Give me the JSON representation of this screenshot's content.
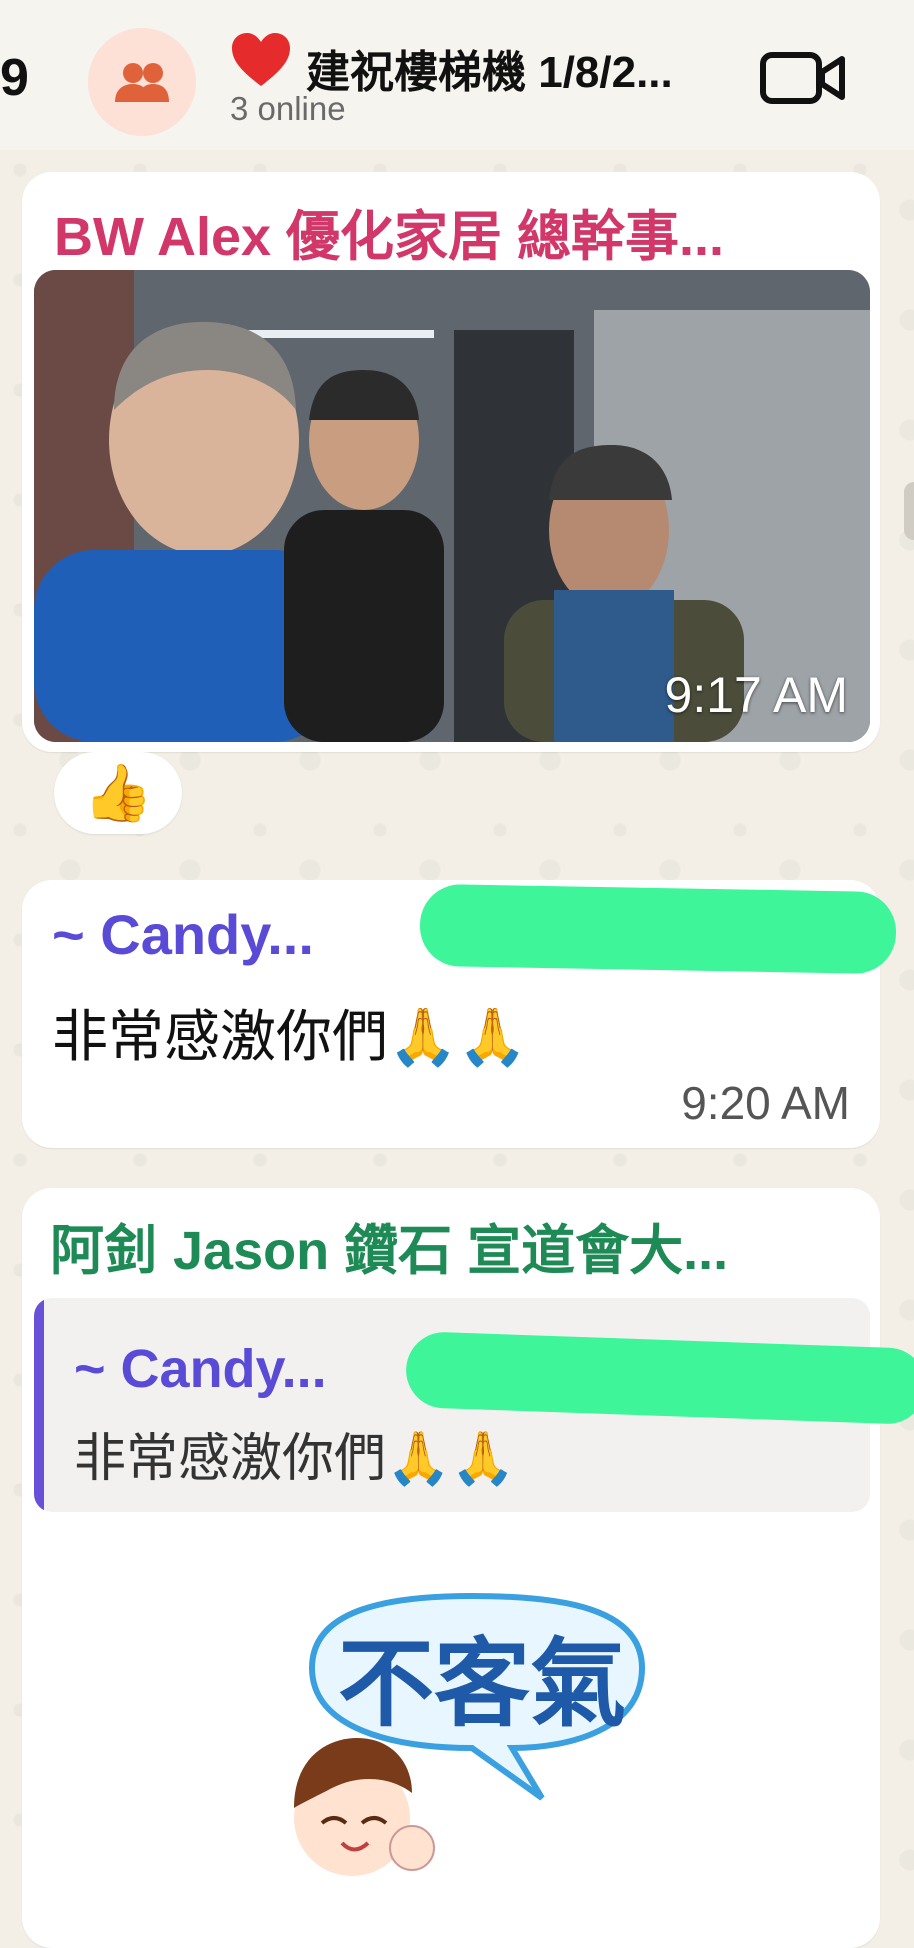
{
  "header": {
    "back_count": "9",
    "title": "建祝樓梯機 1/8/2...",
    "heart": "❤️",
    "subtitle": "3 online",
    "avatar_icon": "group-icon",
    "video_icon": "video-camera-icon"
  },
  "messages": [
    {
      "sender": "BW Alex 優化家居 總幹事...",
      "sender_color": "#d23769",
      "type": "photo",
      "time": "9:17 AM",
      "reaction": "👍"
    },
    {
      "sender": "~ Candy...",
      "sender_color": "#5a4bd6",
      "text": "非常感激你們🙏🙏",
      "time": "9:20 AM"
    },
    {
      "sender": "阿釗 Jason 鑽石 宣道會大...",
      "sender_color": "#1e8a55",
      "quote": {
        "sender": "~ Candy...",
        "text": "非常感激你們🙏🙏"
      },
      "sticker_text": "不客氣"
    }
  ],
  "colors": {
    "background": "#f3efe6",
    "bubble": "#ffffff",
    "redaction": "#3ef59a"
  }
}
